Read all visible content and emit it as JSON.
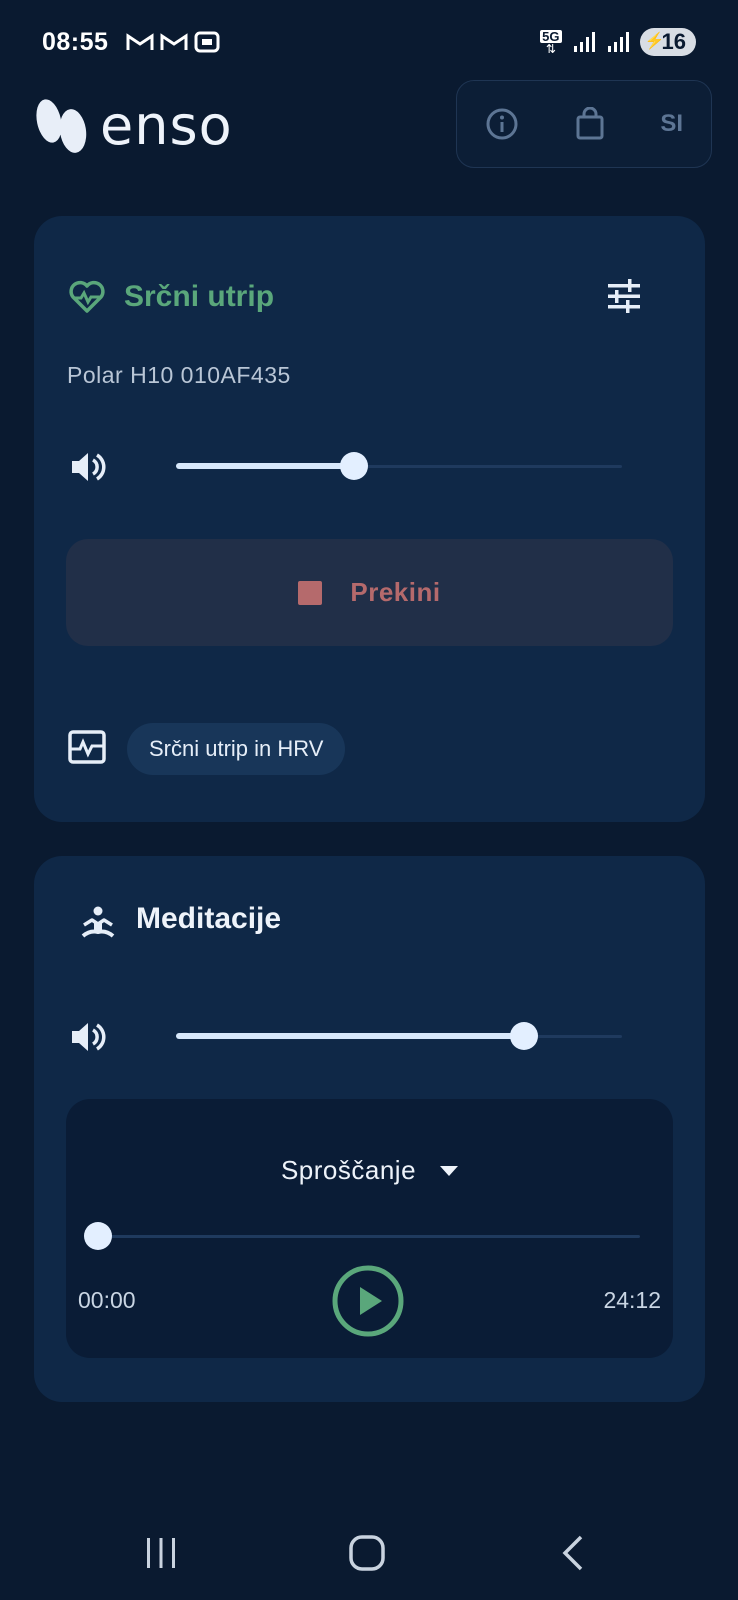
{
  "status_bar": {
    "time": "08:55",
    "network": "5G",
    "battery": "16",
    "notification_icons": [
      "gmail-icon",
      "gmail-icon",
      "screenshot-icon"
    ]
  },
  "header": {
    "brand": "enso",
    "language": "SI"
  },
  "heart_rate_card": {
    "title": "Srčni utrip",
    "device_name": "Polar H10 010AF435",
    "volume_level": 0.4,
    "stop_label": "Prekini",
    "chip_label": "Srčni utrip in HRV"
  },
  "meditation_card": {
    "title": "Meditacije",
    "volume_level": 0.78,
    "track_name": "Sproščanje",
    "time_elapsed": "00:00",
    "time_total": "24:12",
    "progress": 0
  },
  "colors": {
    "background": "#0a1a30",
    "card": "#0f2847",
    "accent_green": "#5aa77b",
    "stop_red": "#b56a6c"
  }
}
